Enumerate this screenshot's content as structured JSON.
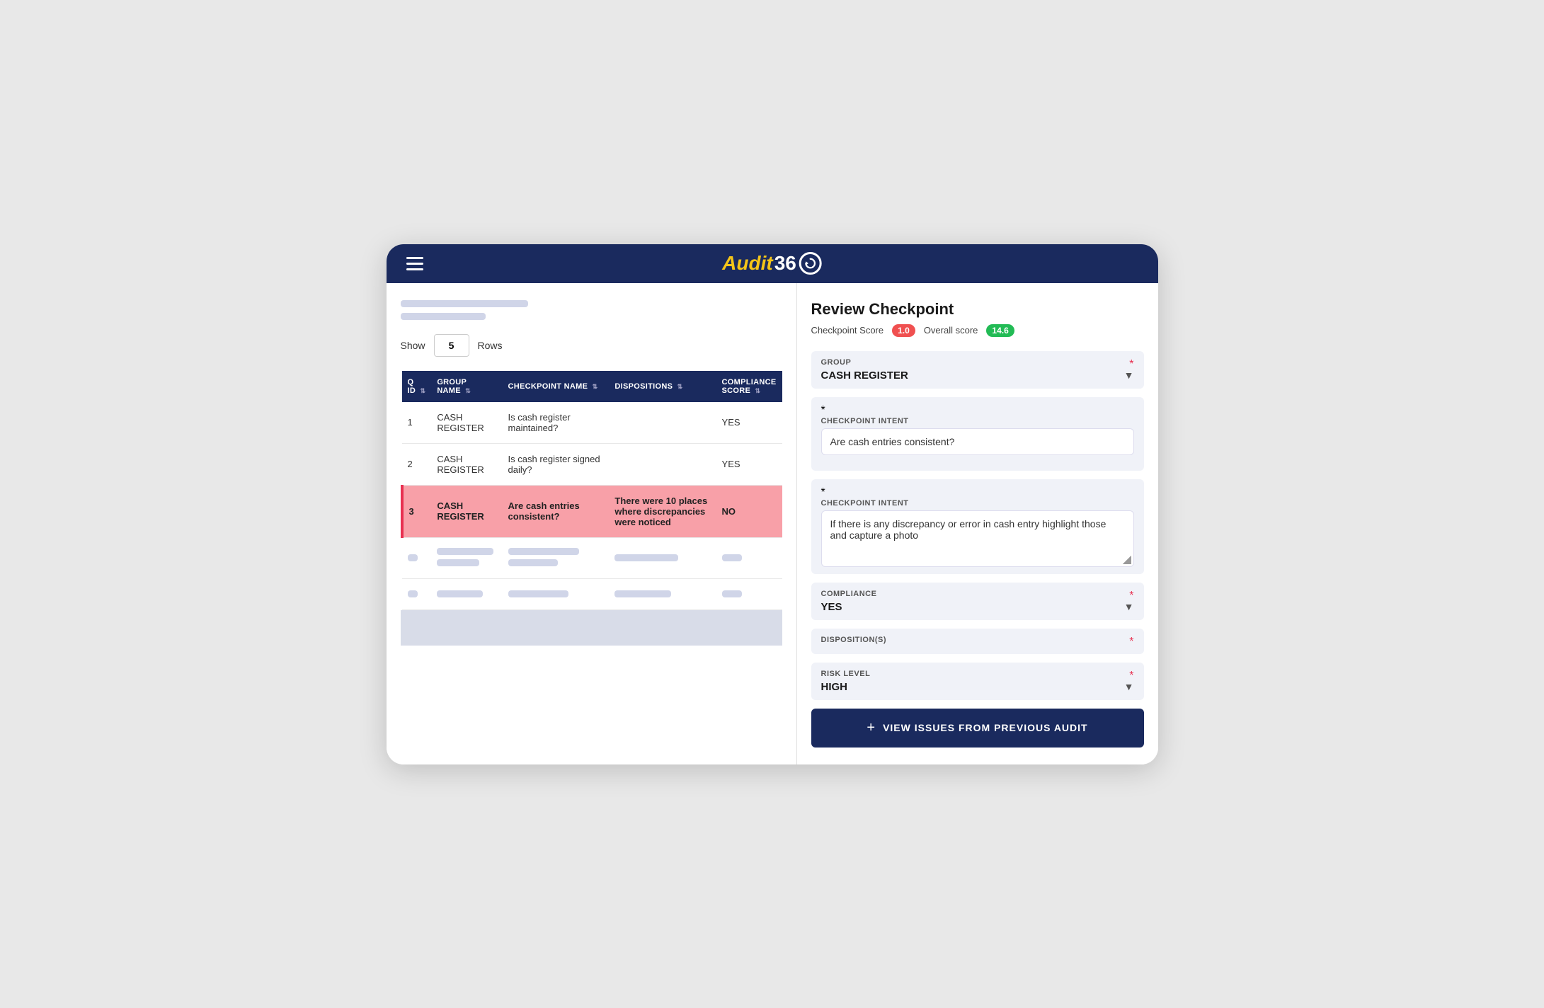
{
  "app": {
    "logo_audit": "Audit",
    "logo_360": "36",
    "title": "Audit360"
  },
  "header": {
    "hamburger_label": "Menu"
  },
  "left_panel": {
    "show_label": "Show",
    "rows_value": "5",
    "rows_label": "Rows",
    "table": {
      "columns": [
        {
          "key": "q_id",
          "label": "Q ID"
        },
        {
          "key": "group_name",
          "label": "GROUP NAME"
        },
        {
          "key": "checkpoint_name",
          "label": "CHECKPOINT NAME"
        },
        {
          "key": "dispositions",
          "label": "DISPOSITIONS"
        },
        {
          "key": "compliance_score",
          "label": "COMPLIANCE SCORE"
        }
      ],
      "rows": [
        {
          "q_id": "1",
          "group_name": "CASH REGISTER",
          "checkpoint_name": "Is cash register maintained?",
          "dispositions": "",
          "compliance_score": "YES",
          "active": false
        },
        {
          "q_id": "2",
          "group_name": "CASH REGISTER",
          "checkpoint_name": "Is cash register signed daily?",
          "dispositions": "",
          "compliance_score": "YES",
          "active": false
        },
        {
          "q_id": "3",
          "group_name": "CASH REGISTER",
          "checkpoint_name": "Are cash entries consistent?",
          "dispositions": "There were 10 places where discrepancies were noticed",
          "compliance_score": "NO",
          "active": true
        },
        {
          "q_id": "",
          "group_name": "",
          "checkpoint_name": "",
          "dispositions": "",
          "compliance_score": "",
          "active": false,
          "placeholder": true
        },
        {
          "q_id": "",
          "group_name": "",
          "checkpoint_name": "",
          "dispositions": "",
          "compliance_score": "",
          "active": false,
          "placeholder": true
        }
      ]
    }
  },
  "right_panel": {
    "title": "Review Checkpoint",
    "checkpoint_score_label": "Checkpoint Score",
    "checkpoint_score_value": "1.0",
    "overall_score_label": "Overall score",
    "overall_score_value": "14.6",
    "group_section": {
      "label": "GROUP",
      "value": "CASH REGISTER"
    },
    "checkpoint_intent_1": {
      "label": "CHECKPOINT INTENT",
      "value": "Are cash entries consistent?"
    },
    "checkpoint_intent_2": {
      "label": "CHECKPOINT INTENT",
      "value": "If there is any discrepancy or error in cash entry highlight those and capture a photo"
    },
    "compliance_section": {
      "label": "COMPLIANCE",
      "value": "YES"
    },
    "disposition_section": {
      "label": "DISPOSITION(S)",
      "value": ""
    },
    "risk_section": {
      "label": "RISK LEVEL",
      "value": "HIGH"
    },
    "view_issues_btn": "+ VIEW ISSUES FROM PREVIOUS AUDIT",
    "view_issues_plus": "+",
    "view_issues_label": "VIEW ISSUES FROM PREVIOUS AUDIT"
  }
}
